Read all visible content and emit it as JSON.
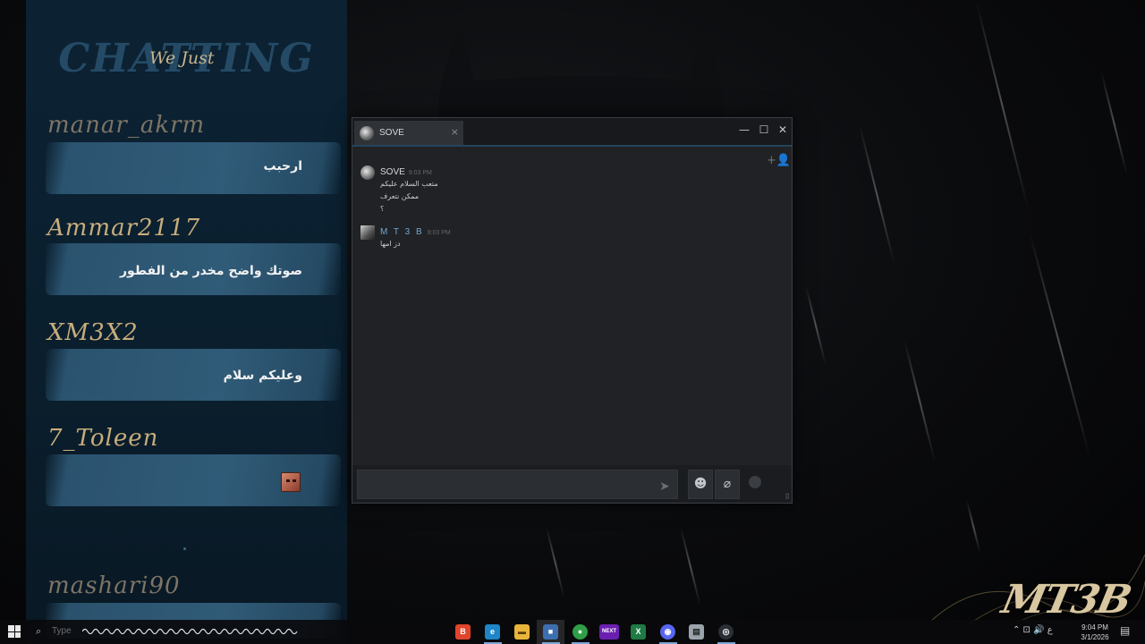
{
  "overlay": {
    "title_big": "CHATTING",
    "title_small": "We Just",
    "entries": [
      {
        "user": "manar_akrm",
        "message": "ارحبب"
      },
      {
        "user": "Ammar2117",
        "message": "صوتك واضح مخدر من الفطور"
      },
      {
        "user": "XM3X2",
        "message": "وعليكم سلام"
      },
      {
        "user": "7_Toleen",
        "message": ""
      },
      {
        "user": "mashari90",
        "message": ""
      }
    ]
  },
  "chat_window": {
    "tab_name": "SOVE",
    "tab_close": "×",
    "controls": {
      "minimize": "—",
      "maximize": "☐",
      "close": "✕"
    },
    "add_friend_icon": "+👤",
    "messages": [
      {
        "name": "SOVE",
        "time": "9:03 PM",
        "lines": [
          "متعب السلام عليكم",
          "ممكن نتعرف",
          "؟"
        ]
      },
      {
        "name": "M T 3 B",
        "time": "9:03 PM",
        "lines": [
          "دز امها"
        ]
      }
    ],
    "composer": {
      "send_icon": "➤",
      "emoji_icon": "☻",
      "attach_icon": "⌀",
      "resize_icon": "⠿"
    }
  },
  "taskbar": {
    "search_placeholder": "Type",
    "apps": [
      {
        "name": "brave",
        "color": "#e0442c",
        "glyph": "B"
      },
      {
        "name": "edge",
        "color": "#1e86c8",
        "glyph": "e"
      },
      {
        "name": "explorer",
        "color": "#e8b53a",
        "glyph": "▬"
      },
      {
        "name": "steam-window",
        "color": "#3d6fb0",
        "glyph": "■"
      },
      {
        "name": "chrome",
        "color": "#2f9e47",
        "glyph": "●"
      },
      {
        "name": "next",
        "color": "#6a1fb0",
        "glyph": "NEXT"
      },
      {
        "name": "excel",
        "color": "#1f7a45",
        "glyph": "X"
      },
      {
        "name": "discord",
        "color": "#5865f2",
        "glyph": "◉"
      },
      {
        "name": "notepad",
        "color": "#9aa3ab",
        "glyph": "▤"
      },
      {
        "name": "steam",
        "color": "#2a2e36",
        "glyph": "◎"
      }
    ],
    "tray_icons": "⌃ ⊡ 🔊 ع",
    "time": "9:04 PM",
    "date": "3/1/2026"
  },
  "wallpaper": {
    "brand": "MT3B"
  }
}
